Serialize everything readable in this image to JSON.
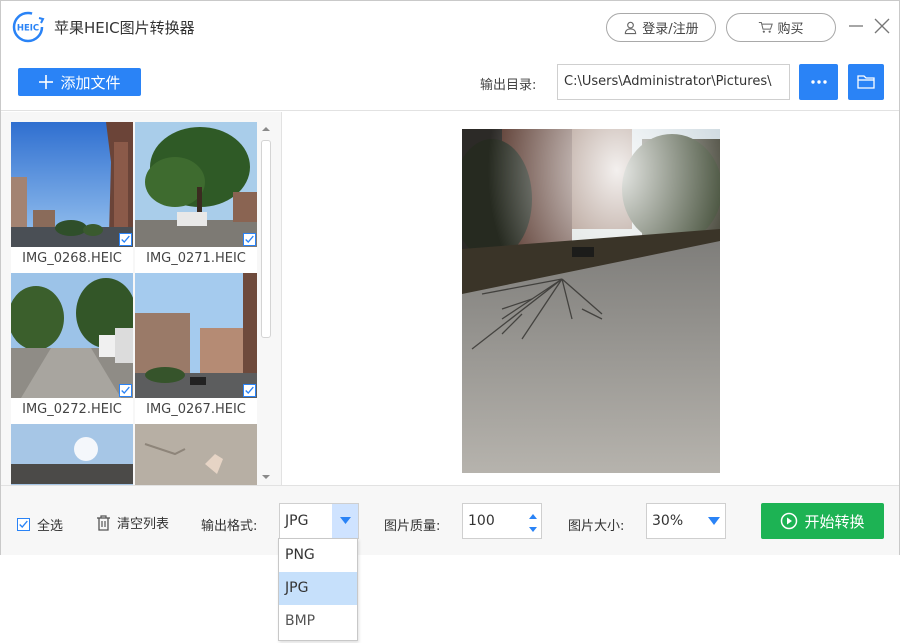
{
  "app": {
    "title": "苹果HEIC图片转换器",
    "logo_text": "HEIC"
  },
  "header": {
    "login_label": "登录/注册",
    "buy_label": "购买"
  },
  "toolbar": {
    "add_label": "添加文件",
    "output_dir_label": "输出目录:",
    "output_dir_value": "C:\\Users\\Administrator\\Pictures\\"
  },
  "files": [
    {
      "name": "IMG_0268.HEIC",
      "checked": true
    },
    {
      "name": "IMG_0271.HEIC",
      "checked": true
    },
    {
      "name": "IMG_0272.HEIC",
      "checked": true
    },
    {
      "name": "IMG_0267.HEIC",
      "checked": true
    }
  ],
  "bottombar": {
    "select_all_label": "全选",
    "clear_list_label": "清空列表",
    "format_label": "输出格式:",
    "format_value": "JPG",
    "quality_label": "图片质量:",
    "quality_value": "100",
    "size_label": "图片大小:",
    "size_value": "30%",
    "start_label": "开始转换"
  },
  "format_options": [
    "PNG",
    "JPG",
    "BMP"
  ],
  "colors": {
    "accent": "#2a83f6",
    "start": "#1db354",
    "selected_option": "#c6e0fb"
  }
}
